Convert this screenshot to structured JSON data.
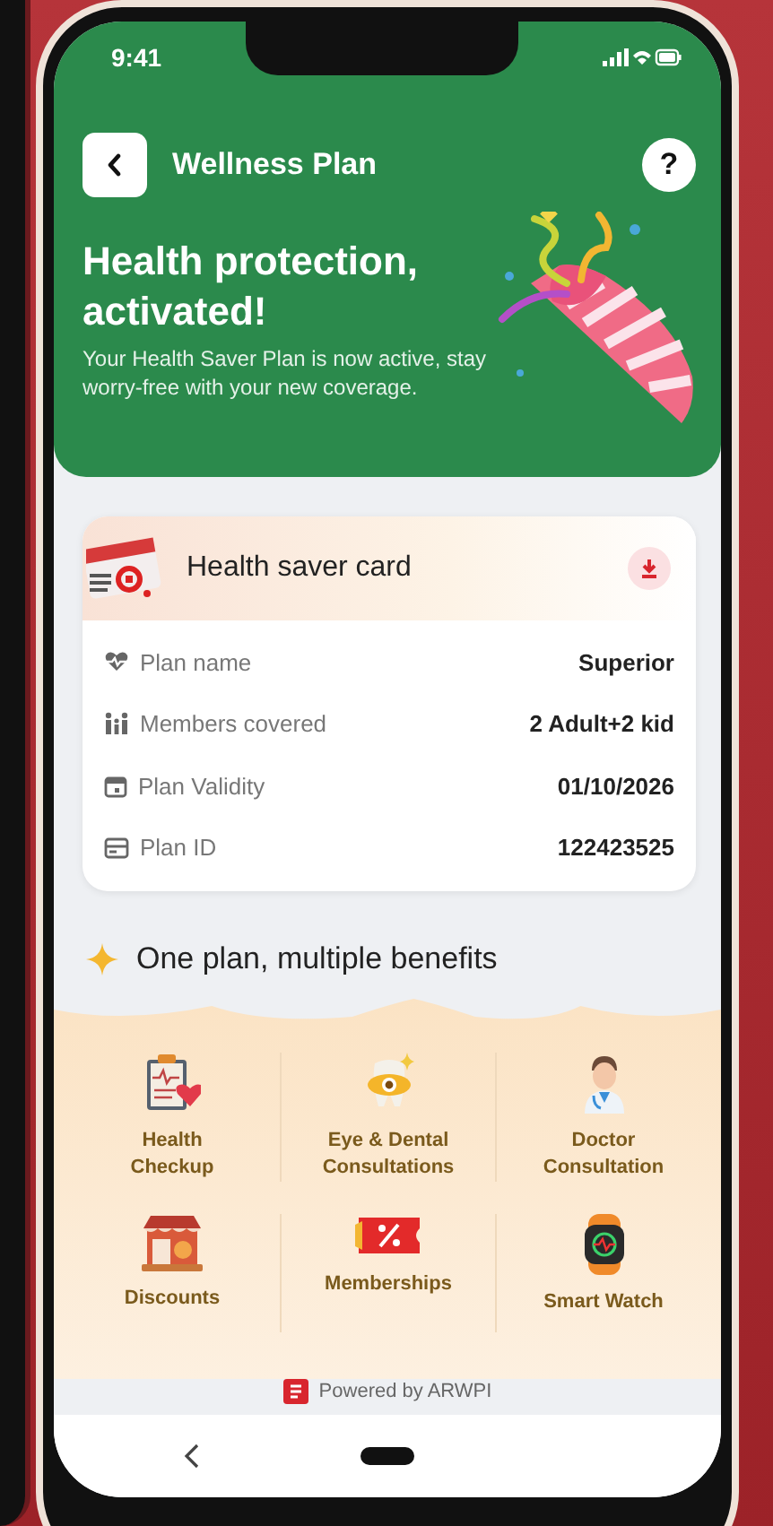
{
  "status_bar": {
    "time": "9:41"
  },
  "header": {
    "title": "Wellness Plan",
    "help": "?"
  },
  "hero": {
    "title": "Health protection, activated!",
    "subtitle": "Your Health Saver Plan is now active, stay worry-free with your new coverage."
  },
  "card": {
    "title": "Health saver card",
    "rows": [
      {
        "kind": "plan",
        "label": "Plan name",
        "value": "Superior"
      },
      {
        "kind": "members",
        "label": "Members covered",
        "value": "2 Adult+2 kid"
      },
      {
        "kind": "validity",
        "label": "Plan Validity",
        "value": "01/10/2026"
      },
      {
        "kind": "id",
        "label": "Plan ID",
        "value": "122423525"
      }
    ]
  },
  "benefits": {
    "title": "One plan, multiple benefits",
    "items": [
      {
        "kind": "checkup",
        "label": "Health\nCheckup"
      },
      {
        "kind": "eye",
        "label": "Eye & Dental\nConsultations"
      },
      {
        "kind": "doctor",
        "label": "Doctor\nConsultation"
      },
      {
        "kind": "discounts",
        "label": "Discounts"
      },
      {
        "kind": "memberships",
        "label": "Memberships"
      },
      {
        "kind": "watch",
        "label": "Smart Watch"
      }
    ]
  },
  "footer": {
    "powered": "Powered by ARWPI"
  }
}
